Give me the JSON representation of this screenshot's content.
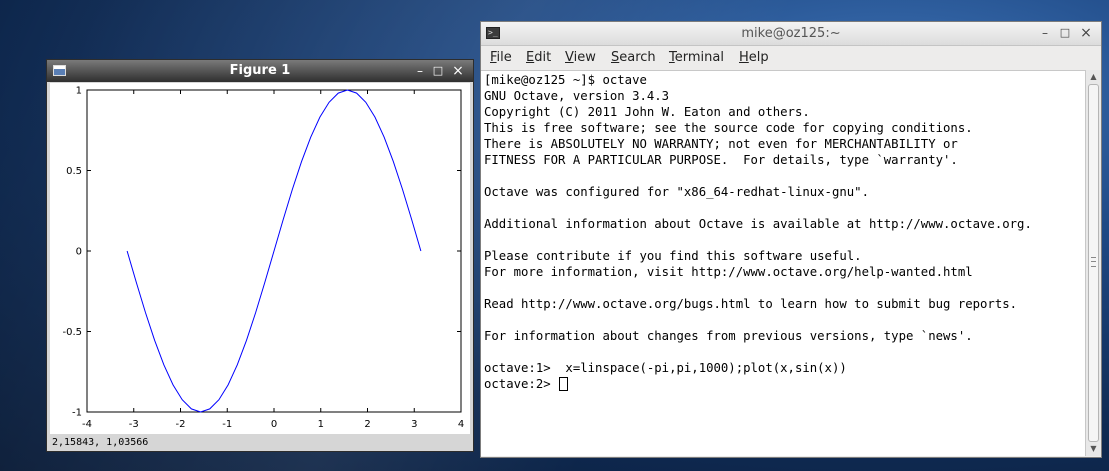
{
  "figure_window": {
    "title": "Figure 1",
    "controls": {
      "minimize": "–",
      "maximize": "□",
      "close": "×"
    },
    "status": "2,15843,  1,03566"
  },
  "chart_data": {
    "type": "line",
    "title": "",
    "xlabel": "",
    "ylabel": "",
    "xlim": [
      -4,
      4
    ],
    "ylim": [
      -1,
      1
    ],
    "xticks": [
      -4,
      -3,
      -2,
      -1,
      0,
      1,
      2,
      3,
      4
    ],
    "xtick_labels": [
      "-4",
      "-3",
      "-2",
      "-1",
      "0",
      "1",
      "2",
      "3",
      "4"
    ],
    "yticks": [
      -1,
      -0.5,
      0,
      0.5,
      1
    ],
    "ytick_labels": [
      "-1",
      "-0.5",
      "0",
      "0.5",
      "1"
    ],
    "grid": false,
    "series": [
      {
        "color": "#0000ff",
        "x": [
          -3.1416,
          -2.9452,
          -2.7489,
          -2.5525,
          -2.3562,
          -2.1598,
          -1.9635,
          -1.7671,
          -1.5708,
          -1.3744,
          -1.1781,
          -0.9817,
          -0.7854,
          -0.589,
          -0.3927,
          -0.1963,
          0.0,
          0.1963,
          0.3927,
          0.589,
          0.7854,
          0.9817,
          1.1781,
          1.3744,
          1.5708,
          1.7671,
          1.9635,
          2.1598,
          2.3562,
          2.5525,
          2.7489,
          2.9452,
          3.1416
        ],
        "y": [
          0.0,
          -0.1951,
          -0.3827,
          -0.5556,
          -0.7071,
          -0.8315,
          -0.9239,
          -0.9808,
          -1.0,
          -0.9808,
          -0.9239,
          -0.8315,
          -0.7071,
          -0.5556,
          -0.3827,
          -0.1951,
          0.0,
          0.1951,
          0.3827,
          0.5556,
          0.7071,
          0.8315,
          0.9239,
          0.9808,
          1.0,
          0.9808,
          0.9239,
          0.8315,
          0.7071,
          0.5556,
          0.3827,
          0.1951,
          0.0
        ]
      }
    ]
  },
  "terminal": {
    "title": "mike@oz125:~",
    "controls": {
      "minimize": "–",
      "maximize": "□",
      "close": "×"
    },
    "menu": [
      {
        "ul": "F",
        "rest": "ile"
      },
      {
        "ul": "E",
        "rest": "dit"
      },
      {
        "ul": "V",
        "rest": "iew"
      },
      {
        "ul": "S",
        "rest": "earch"
      },
      {
        "ul": "T",
        "rest": "erminal"
      },
      {
        "ul": "H",
        "rest": "elp"
      }
    ],
    "lines": [
      "[mike@oz125 ~]$ octave",
      "GNU Octave, version 3.4.3",
      "Copyright (C) 2011 John W. Eaton and others.",
      "This is free software; see the source code for copying conditions.",
      "There is ABSOLUTELY NO WARRANTY; not even for MERCHANTABILITY or",
      "FITNESS FOR A PARTICULAR PURPOSE.  For details, type `warranty'.",
      "",
      "Octave was configured for \"x86_64-redhat-linux-gnu\".",
      "",
      "Additional information about Octave is available at http://www.octave.org.",
      "",
      "Please contribute if you find this software useful.",
      "For more information, visit http://www.octave.org/help-wanted.html",
      "",
      "Read http://www.octave.org/bugs.html to learn how to submit bug reports.",
      "",
      "For information about changes from previous versions, type `news'.",
      "",
      "octave:1>  x=linspace(-pi,pi,1000);plot(x,sin(x))"
    ],
    "prompt": "octave:2> "
  }
}
